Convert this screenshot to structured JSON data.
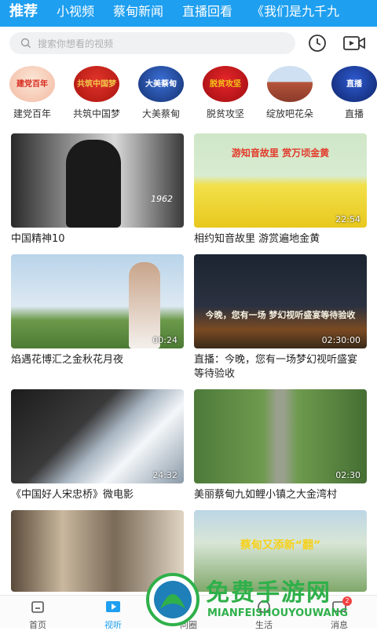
{
  "tabs": [
    {
      "label": "推荐"
    },
    {
      "label": "小视频"
    },
    {
      "label": "蔡甸新闻"
    },
    {
      "label": "直播回看"
    },
    {
      "label": "《我们是九千九"
    }
  ],
  "search": {
    "placeholder": "搜索你想看的视频"
  },
  "icons": {
    "search": "search-icon",
    "history": "clock-icon",
    "video": "video-camera-icon"
  },
  "channels": [
    {
      "label": "建党百年",
      "art": "建党百年",
      "color": "#d8281e"
    },
    {
      "label": "共筑中国梦",
      "art": "共筑中国梦",
      "color": "#e8b21c"
    },
    {
      "label": "大美蔡甸",
      "art": "大美蔡甸",
      "color": "#ffffff"
    },
    {
      "label": "脱贫攻坚",
      "art": "脱贫攻坚",
      "color": "#f5c518"
    },
    {
      "label": "绽放吧花朵",
      "art": "",
      "color": "#ffffff"
    },
    {
      "label": "直播",
      "art": "直播",
      "color": "#ffffff"
    }
  ],
  "videos": [
    {
      "title": "中国精神10",
      "duration": "",
      "overlay": "1962"
    },
    {
      "title": "相约知音故里 游赏遍地金黄",
      "duration": "22:54",
      "overlay": "游知音故里  赏万顷金黄"
    },
    {
      "title": "焰遇花博汇之金秋花月夜",
      "duration": "00:24",
      "overlay": ""
    },
    {
      "title": "直播：今晚，您有一场梦幻视听盛宴等待验收",
      "duration": "02:30:00",
      "overlay": "今晚，您有一场  梦幻视听盛宴等待验收"
    },
    {
      "title": "《中国好人宋忠桥》微电影",
      "duration": "24:32",
      "overlay": ""
    },
    {
      "title": "美丽蔡甸九如鲤小镇之大金湾村",
      "duration": "02:30",
      "overlay": ""
    },
    {
      "title": "",
      "duration": "",
      "overlay": ""
    },
    {
      "title": "",
      "duration": "",
      "overlay": "蔡甸又添新“翻”"
    }
  ],
  "bottom_nav": [
    {
      "label": "首页",
      "icon": "home-icon"
    },
    {
      "label": "视听",
      "icon": "play-icon"
    },
    {
      "label": "问圈",
      "icon": "compass-icon"
    },
    {
      "label": "生活",
      "icon": "life-icon"
    },
    {
      "label": "消息",
      "icon": "message-icon"
    }
  ],
  "badge_count": "2",
  "watermark": {
    "cn": "免费手游网",
    "en": "MIANFEISHOUYOUWANG"
  },
  "colors": {
    "accent": "#1e9ff0",
    "watermark": "#2fb04a"
  }
}
